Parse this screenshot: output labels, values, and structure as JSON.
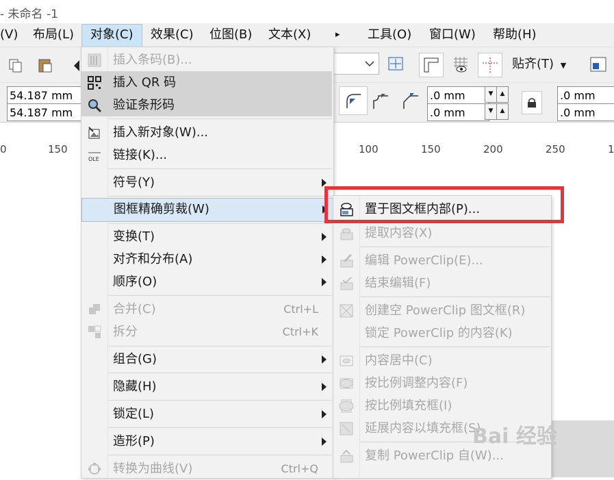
{
  "window": {
    "title": "- 未命名 -1"
  },
  "menubar": {
    "items": [
      "(V)",
      "布局(L)",
      "对象(C)",
      "效果(C)",
      "位图(B)",
      "文本(X)",
      "▸",
      "工具(O)",
      "窗口(W)",
      "帮助(H)"
    ]
  },
  "toolbar": {
    "snap_label": "贴齐(T)",
    "x_value": "54.187 mm",
    "y_value": "54.187 mm",
    "field1": ".0 mm",
    "field2": ".0 mm",
    "field3": ".0 mm",
    "field4": ".0 mm"
  },
  "ruler": {
    "labels": [
      "0",
      "150",
      "100",
      "150",
      "200",
      "250",
      "1"
    ]
  },
  "object_menu": {
    "items": [
      {
        "label": "插入条码(B)...",
        "disabled": true
      },
      {
        "label": "插入 QR 码",
        "disabled": false
      },
      {
        "label": "验证条形码",
        "disabled": false
      },
      {
        "label": "插入新对象(W)...",
        "disabled": false
      },
      {
        "label": "链接(K)...",
        "disabled": false
      },
      {
        "label": "符号(Y)",
        "disabled": false
      },
      {
        "label": "图框精确剪裁(W)",
        "disabled": false
      },
      {
        "label": "变换(T)",
        "disabled": false
      },
      {
        "label": "对齐和分布(A)",
        "disabled": false
      },
      {
        "label": "顺序(O)",
        "disabled": false
      },
      {
        "label": "合并(C)",
        "disabled": true,
        "shortcut": "Ctrl+L"
      },
      {
        "label": "拆分",
        "disabled": true,
        "shortcut": "Ctrl+K"
      },
      {
        "label": "组合(G)",
        "disabled": false
      },
      {
        "label": "隐藏(H)",
        "disabled": false
      },
      {
        "label": "锁定(L)",
        "disabled": false
      },
      {
        "label": "造形(P)",
        "disabled": false
      },
      {
        "label": "转换为曲线(V)",
        "disabled": true,
        "shortcut": "Ctrl+Q"
      }
    ]
  },
  "powerclip_menu": {
    "items": [
      {
        "label": "置于图文框内部(P)...",
        "disabled": false
      },
      {
        "label": "提取内容(X)",
        "disabled": true
      },
      {
        "label": "编辑 PowerClip(E)...",
        "disabled": true
      },
      {
        "label": "结束编辑(F)",
        "disabled": true
      },
      {
        "label": "创建空 PowerClip 图文框(R)",
        "disabled": true
      },
      {
        "label": "锁定 PowerClip 的内容(K)",
        "disabled": true
      },
      {
        "label": "内容居中(C)",
        "disabled": true
      },
      {
        "label": "按比例调整内容(F)",
        "disabled": true
      },
      {
        "label": "按比例填充框(I)",
        "disabled": true
      },
      {
        "label": "延展内容以填充框(S)",
        "disabled": true
      },
      {
        "label": "复制 PowerClip 自(W)...",
        "disabled": true
      }
    ]
  },
  "watermark": {
    "text": "Bai 经验"
  },
  "colors": {
    "highlight_box": "#e8323c",
    "menu_selected": "#d9e8f7",
    "menubar_active": "#cce4f7"
  }
}
